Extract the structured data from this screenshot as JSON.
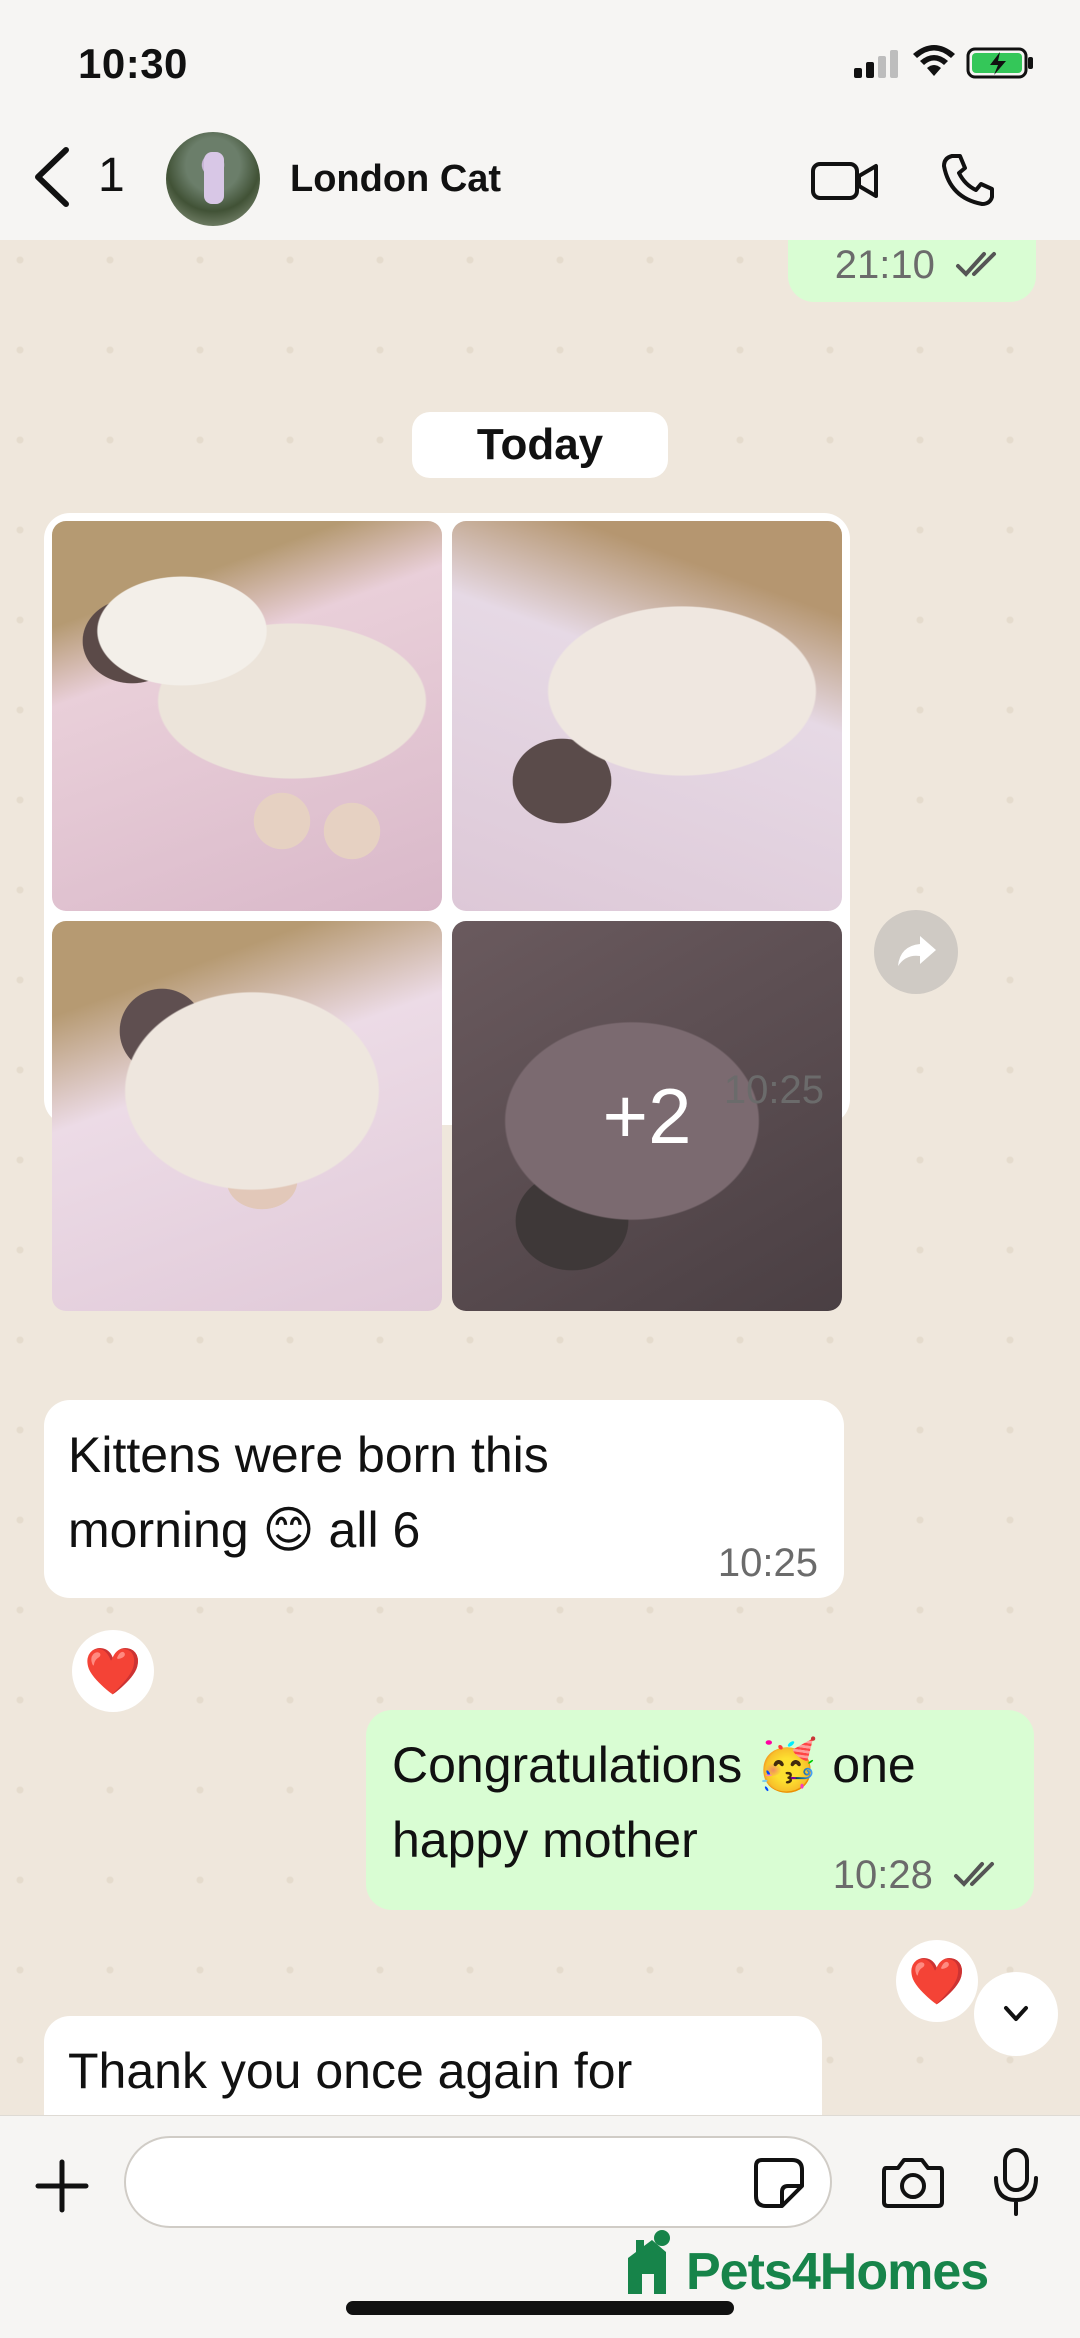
{
  "status_bar": {
    "time": "10:30"
  },
  "header": {
    "unread_count": "1",
    "contact_name": "London Cat"
  },
  "chat": {
    "previous_message_time": "21:10",
    "date_separator": "Today",
    "album": {
      "more_count": "+2",
      "time": "10:25"
    },
    "messages": [
      {
        "direction": "in",
        "text": "Kittens were born this morning 😊 all 6",
        "time": "10:25",
        "reaction": "❤️"
      },
      {
        "direction": "out",
        "text": "Congratulations 🥳 one happy mother",
        "time": "10:28",
        "reaction": "❤️"
      },
      {
        "direction": "in",
        "text": "Thank you once again for",
        "time": ""
      }
    ]
  },
  "composer": {
    "placeholder": ""
  },
  "watermark": {
    "text": "Pets4Homes"
  },
  "colors": {
    "outgoing_bubble": "#d9fdd3",
    "incoming_bubble": "#ffffff",
    "chat_background": "#efe7dc",
    "read_ticks": "#53bdeb",
    "brand_green": "#17844a"
  }
}
